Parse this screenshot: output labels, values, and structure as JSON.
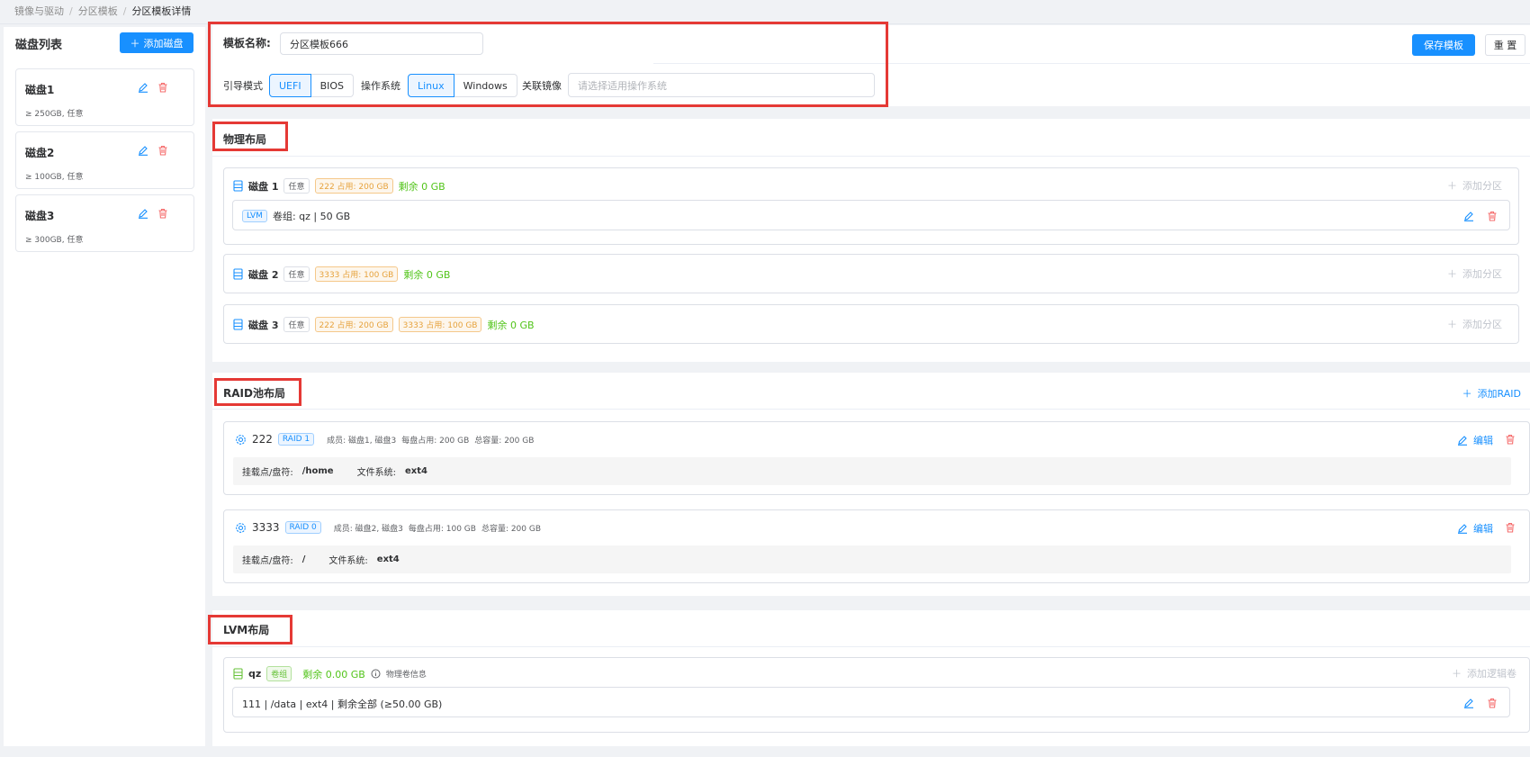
{
  "breadcrumb": [
    "镜像与驱动",
    "分区模板",
    "分区模板详情"
  ],
  "disk_list": {
    "title": "磁盘列表",
    "add_label": "添加磁盘",
    "items": [
      {
        "name": "磁盘1",
        "info": "≥ 250GB, 任意"
      },
      {
        "name": "磁盘2",
        "info": "≥ 100GB, 任意"
      },
      {
        "name": "磁盘3",
        "info": "≥ 300GB, 任意"
      }
    ]
  },
  "form": {
    "name_label": "模板名称:",
    "name_value": "分区模板666",
    "boot_label": "引导模式",
    "boot_options": [
      "UEFI",
      "BIOS"
    ],
    "boot_selected": "UEFI",
    "os_label": "操作系统",
    "os_options": [
      "Linux",
      "Windows"
    ],
    "os_selected": "Linux",
    "image_label": "关联镜像",
    "image_placeholder": "请选择适用操作系统"
  },
  "actions": {
    "save_label": "保存模板",
    "reset_label": "重 置"
  },
  "physical": {
    "title": "物理布局",
    "add_partition_label": "添加分区",
    "disks": [
      {
        "name": "磁盘 1",
        "type": "任意",
        "usages": [
          "222 占用: 200 GB"
        ],
        "remaining": "剩余 0 GB",
        "partitions": [
          {
            "tag": "LVM",
            "text": "卷组: qz | 50 GB"
          }
        ]
      },
      {
        "name": "磁盘 2",
        "type": "任意",
        "usages": [
          "3333 占用: 100 GB"
        ],
        "remaining": "剩余 0 GB",
        "partitions": []
      },
      {
        "name": "磁盘 3",
        "type": "任意",
        "usages": [
          "222 占用: 200 GB",
          "3333 占用: 100 GB"
        ],
        "remaining": "剩余 0 GB",
        "partitions": []
      }
    ]
  },
  "raid": {
    "title": "RAID池布局",
    "add_label": "添加RAID",
    "edit_label": "编辑",
    "mount_label": "挂载点/盘符:",
    "fs_label": "文件系统:",
    "pools": [
      {
        "name": "222",
        "level": "RAID 1",
        "members": "成员: 磁盘1, 磁盘3",
        "per_disk": "每盘占用: 200 GB",
        "total": "总容量: 200 GB",
        "mount": "/home",
        "fs": "ext4"
      },
      {
        "name": "3333",
        "level": "RAID 0",
        "members": "成员: 磁盘2, 磁盘3",
        "per_disk": "每盘占用: 100 GB",
        "total": "总容量: 200 GB",
        "mount": "/",
        "fs": "ext4"
      }
    ]
  },
  "lvm": {
    "title": "LVM布局",
    "vg_name": "qz",
    "vg_tag": "卷组",
    "remaining": "剩余 0.00 GB",
    "pv_info": "物理卷信息",
    "add_lv_label": "添加逻辑卷",
    "volumes": [
      {
        "text": "111 | /data | ext4 | 剩余全部 (≥50.00 GB)"
      }
    ]
  },
  "colors": {
    "primary": "#1890ff",
    "danger": "#f56c6c",
    "success": "#52c41a",
    "highlight": "#e53935"
  }
}
